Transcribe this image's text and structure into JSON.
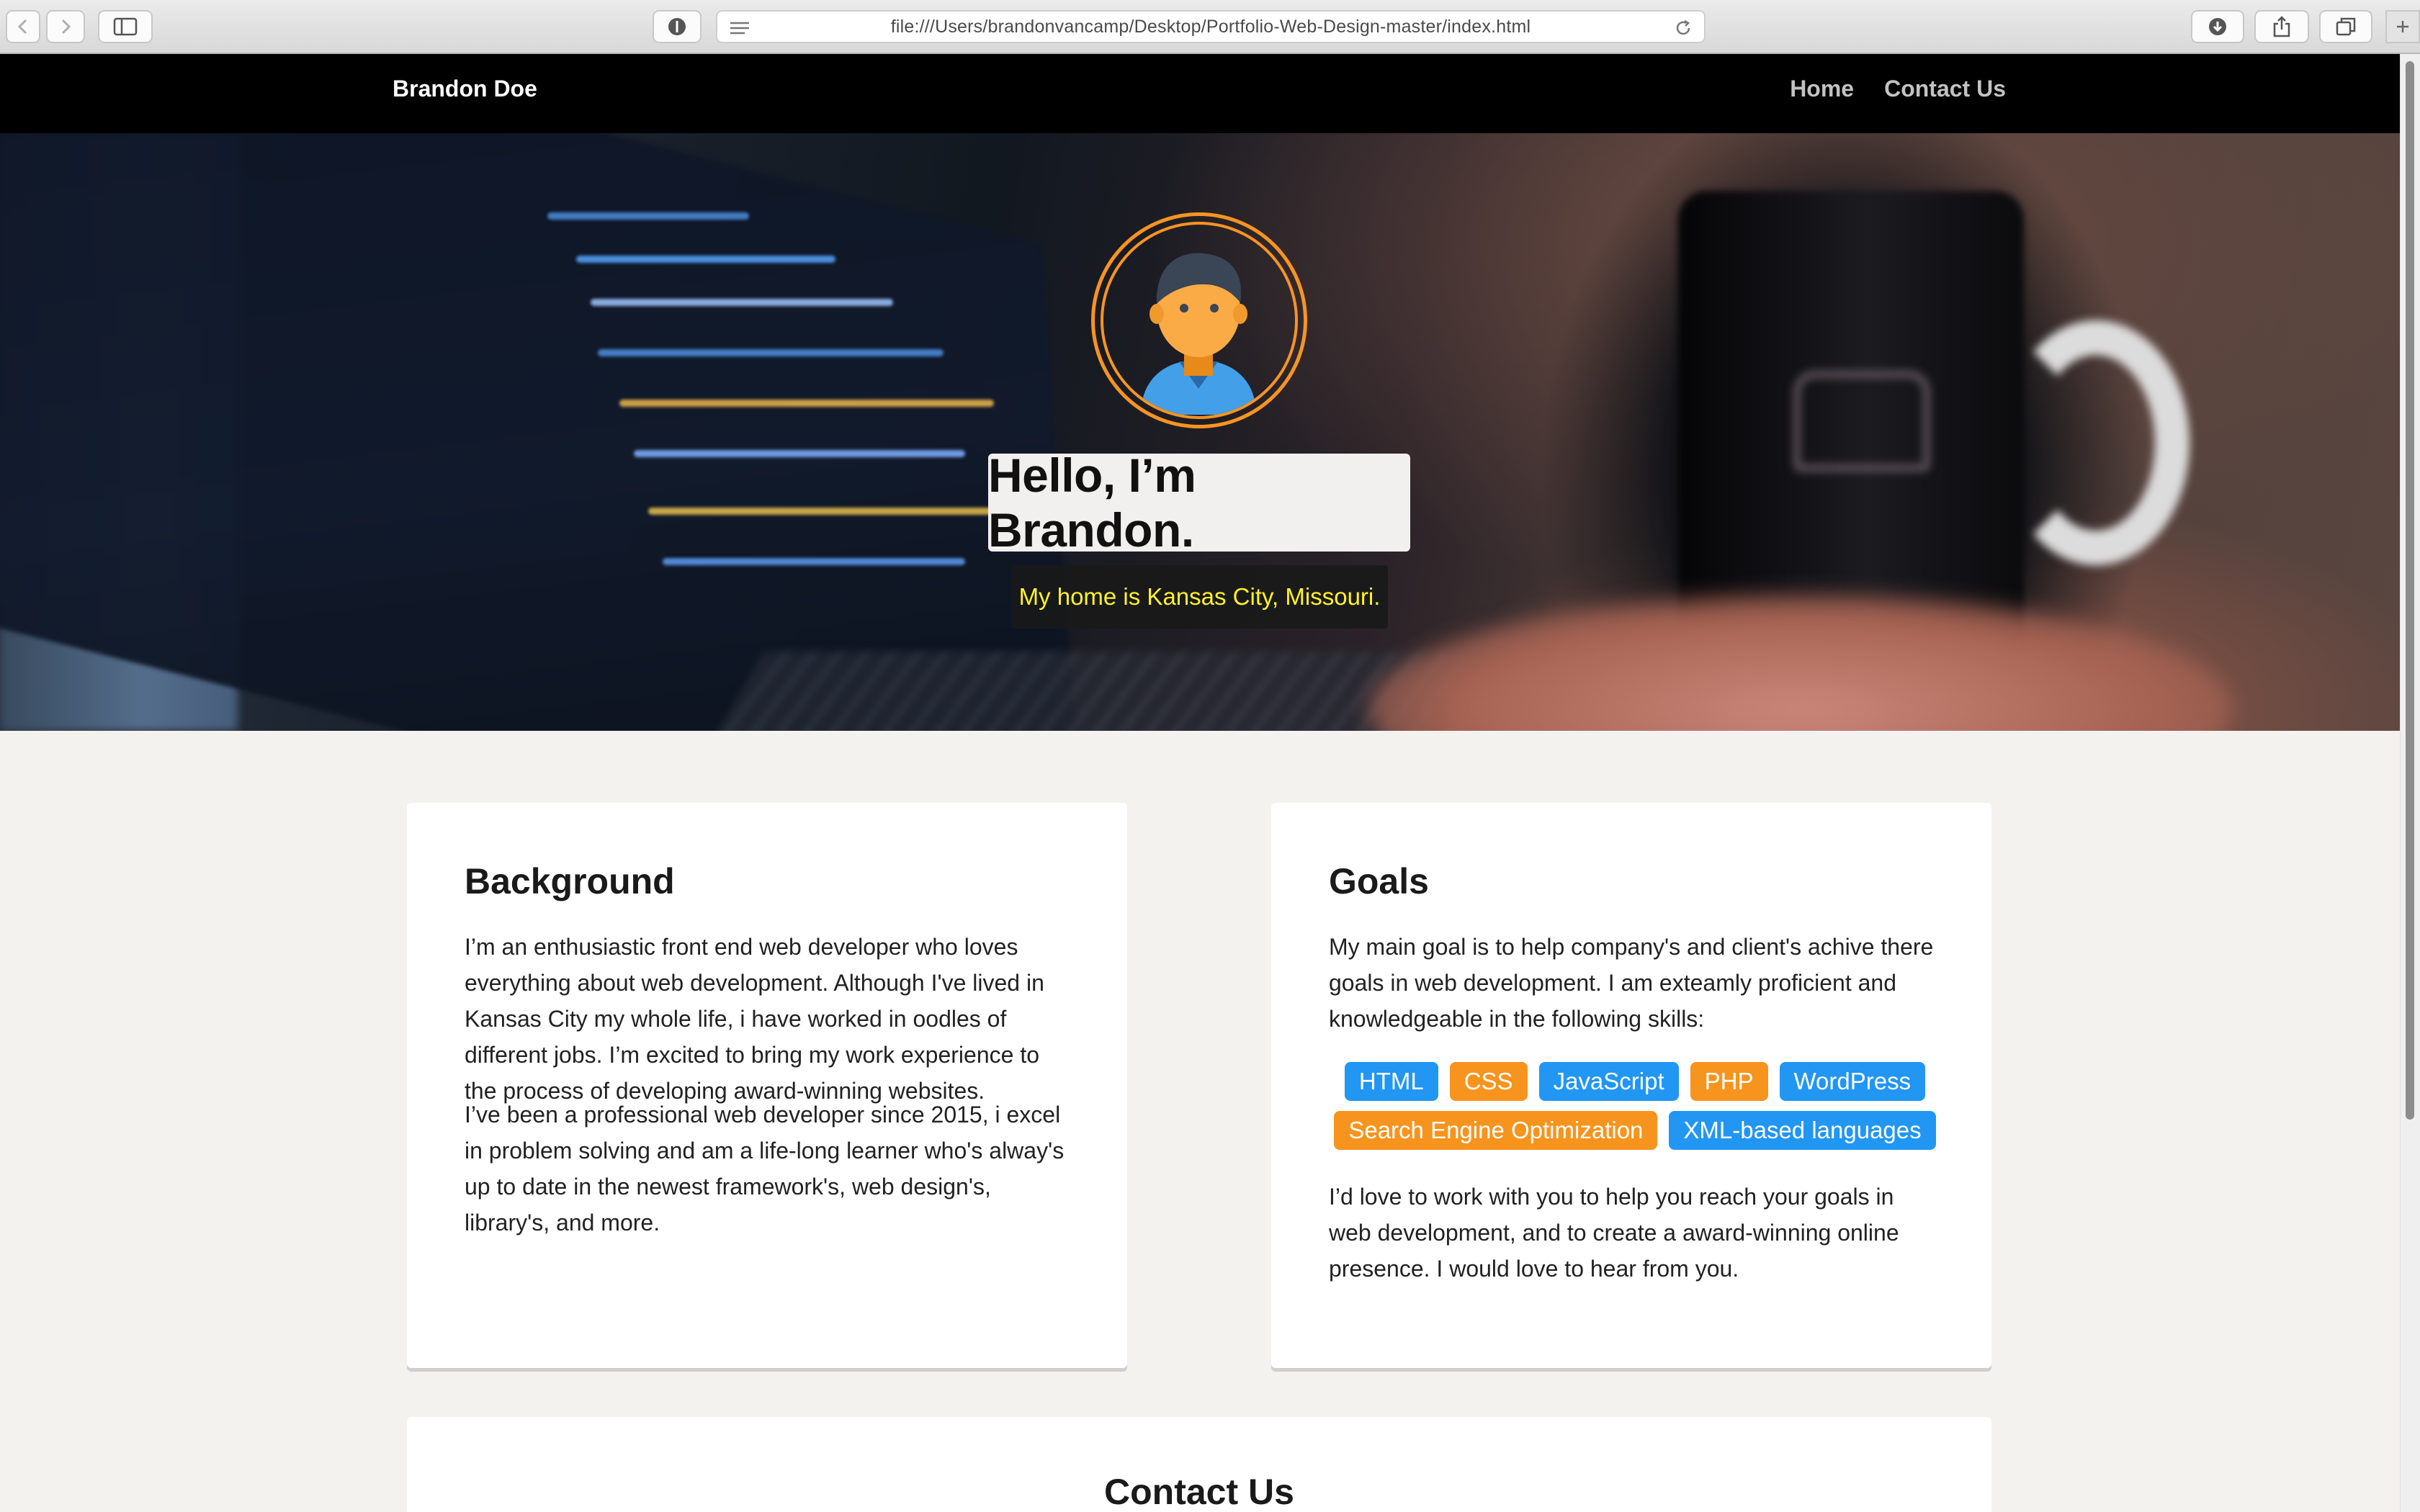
{
  "browser": {
    "url": "file:///Users/brandonvancamp/Desktop/Portfolio-Web-Design-master/index.html"
  },
  "site": {
    "brand": "Brandon Doe",
    "nav": [
      {
        "label": "Home"
      },
      {
        "label": "Contact Us"
      }
    ]
  },
  "hero": {
    "title": "Hello, I’m Brandon.",
    "subtitle": "My home is Kansas City, Missouri.",
    "accent_color": "#f79421",
    "subtitle_color": "#fff22a"
  },
  "background": {
    "heading": "Background",
    "p1": "I’m an enthusiastic front end web developer who loves everything about web development. Although I've lived in Kansas City my whole life, i have worked in oodles of different jobs. I’m excited to bring my work experience to the process of developing award-winning websites.",
    "p2": "I’ve been a professional web developer since 2015, i excel in problem solving and am a life-long learner who's alway's up to date in the newest framework's, web design's, library's, and more."
  },
  "goals": {
    "heading": "Goals",
    "p1": "My main goal is to help company's and client's achive there goals in web development. I am exteamly proficient and knowledgeable in the following skills:",
    "skills": [
      {
        "label": "HTML",
        "color": "#2196f3"
      },
      {
        "label": "CSS",
        "color": "#f7941d"
      },
      {
        "label": "JavaScript",
        "color": "#2196f3"
      },
      {
        "label": "PHP",
        "color": "#f7941d"
      },
      {
        "label": "WordPress",
        "color": "#2196f3"
      },
      {
        "label": "Search Engine Optimization",
        "color": "#f7941d"
      },
      {
        "label": "XML-based languages",
        "color": "#2196f3"
      }
    ],
    "p2": "I’d love to work with you to help you reach your goals in web development, and to create a award-winning online presence. I would love to hear from you."
  },
  "contact": {
    "heading": "Contact Us"
  }
}
